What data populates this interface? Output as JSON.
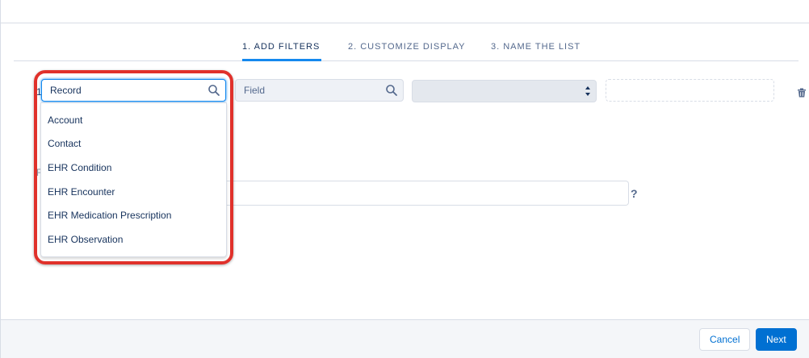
{
  "tabs": [
    {
      "label": "1. ADD FILTERS",
      "active": true
    },
    {
      "label": "2. CUSTOMIZE DISPLAY",
      "active": false
    },
    {
      "label": "3. NAME THE LIST",
      "active": false
    }
  ],
  "filter_row": {
    "number": "1",
    "record_input": {
      "value": "Record",
      "icon": "search-icon"
    },
    "field_input": {
      "placeholder": "Field",
      "icon": "search-icon"
    },
    "operator_select": {
      "value": "",
      "icon": "select-arrows-icon"
    },
    "value_input": {
      "value": ""
    },
    "delete_icon": "trash-icon"
  },
  "record_dropdown": {
    "items": [
      "Account",
      "Contact",
      "EHR Condition",
      "EHR Encounter",
      "EHR Medication Prescription",
      "EHR Observation"
    ]
  },
  "logic": {
    "value": "",
    "help": "?"
  },
  "footer": {
    "cancel_label": "Cancel",
    "next_label": "Next"
  },
  "colors": {
    "accent": "#0070d2",
    "highlight": "#e0312b",
    "focus": "#1589ee"
  }
}
